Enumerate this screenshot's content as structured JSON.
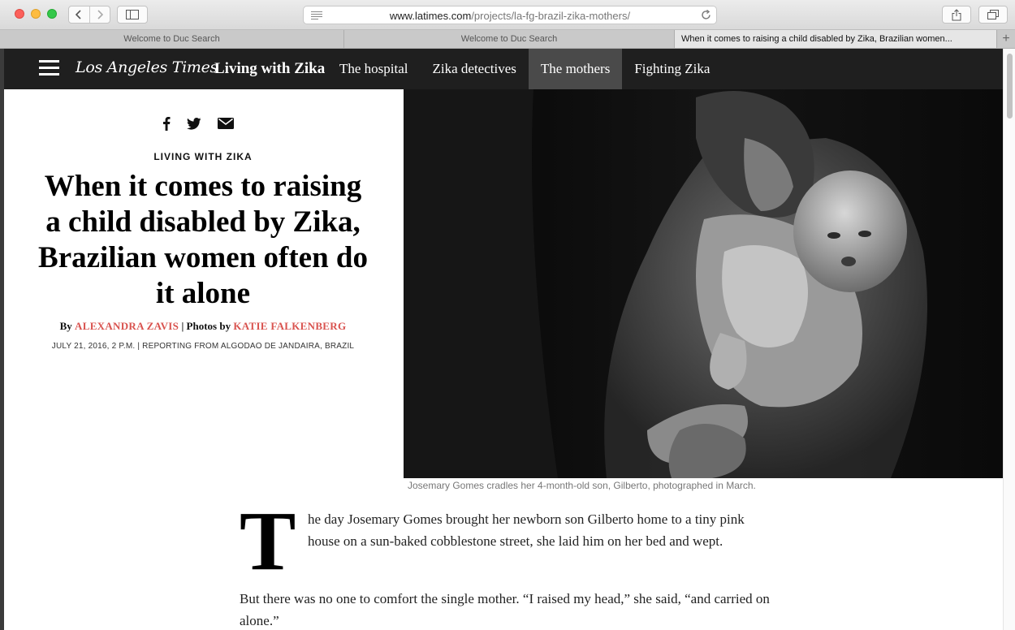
{
  "browser": {
    "url_domain": "www.latimes.com",
    "url_path": "/projects/la-fg-brazil-zika-mothers/",
    "tabs": [
      {
        "label": "Welcome to Duc Search"
      },
      {
        "label": "Welcome to Duc Search"
      },
      {
        "label": "When it comes to raising a child disabled by Zika, Brazilian women..."
      }
    ]
  },
  "site": {
    "logo": "Los Angeles Times",
    "section_title": "Living with Zika",
    "nav": [
      {
        "label": "The hospital"
      },
      {
        "label": "Zika detectives"
      },
      {
        "label": "The mothers"
      },
      {
        "label": "Fighting Zika"
      }
    ]
  },
  "article": {
    "kicker": "LIVING WITH ZIKA",
    "headline": "When it comes to raising a child disabled by Zika, Brazilian women often do it alone",
    "byline_prefix": "By",
    "author": "ALEXANDRA ZAVIS",
    "photos_prefix": "| Photos by",
    "photographer": "KATIE FALKENBERG",
    "dateline": "JULY 21, 2016, 2 P.M. | REPORTING FROM ALGODAO DE JANDAIRA, BRAZIL",
    "caption": "Josemary Gomes cradles her 4-month-old son, Gilberto, photographed in March.",
    "dropcap": "T",
    "para1": "he day Josemary Gomes brought her newborn son Gilberto home to a tiny pink house on a sun-baked cobblestone street, she laid him on her bed and wept.",
    "para2": "But there was no one to comfort the single mother. “I raised my head,” she said, “and carried on alone.”"
  },
  "colors": {
    "accent_red": "#d9534f",
    "header_bg": "#1f1f1f",
    "active_nav": "#4a4a4a"
  }
}
